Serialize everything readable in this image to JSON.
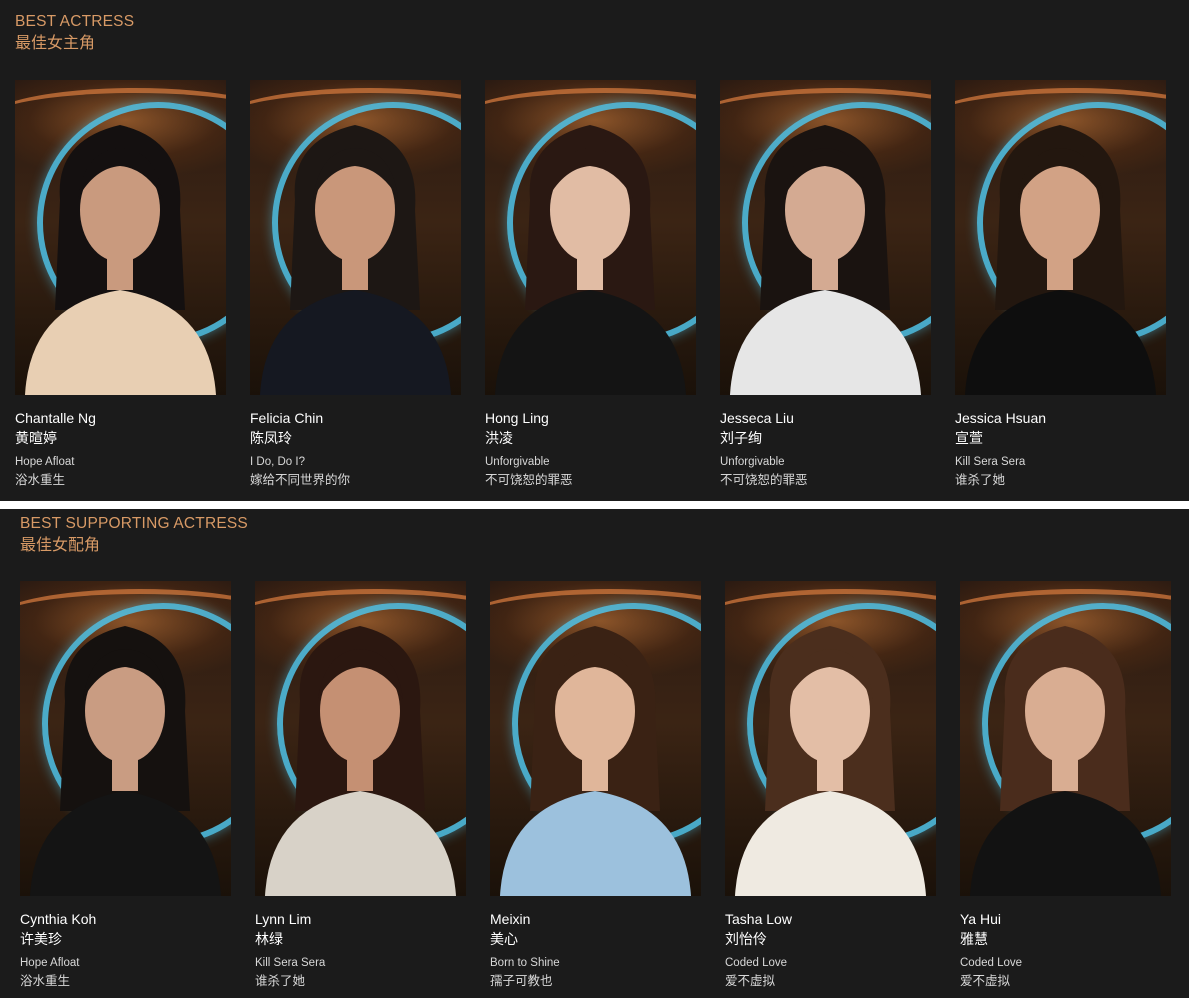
{
  "categories": [
    {
      "title": "BEST ACTRESS",
      "title_zh": "最佳女主角",
      "nominees": [
        {
          "name_en": "Chantalle Ng",
          "name_zh": "黄暄婷",
          "film_en": "Hope Afloat",
          "film_zh": "浴水重生",
          "hair": "#141010",
          "skin": "#c99a7e",
          "outfit": "#e8cfb3"
        },
        {
          "name_en": "Felicia Chin",
          "name_zh": "陈凤玲",
          "film_en": "I Do, Do I?",
          "film_zh": "嫁给不同世界的你",
          "hair": "#1d1714",
          "skin": "#c9977a",
          "outfit": "#151821"
        },
        {
          "name_en": "Hong Ling",
          "name_zh": "洪凌",
          "film_en": "Unforgivable",
          "film_zh": "不可饶恕的罪恶",
          "hair": "#2a1812",
          "skin": "#e1bca4",
          "outfit": "#141414"
        },
        {
          "name_en": "Jesseca Liu",
          "name_zh": "刘子绚",
          "film_en": "Unforgivable",
          "film_zh": "不可饶恕的罪恶",
          "hair": "#1a1310",
          "skin": "#d4aa92",
          "outfit": "#e6e6e6"
        },
        {
          "name_en": "Jessica Hsuan",
          "name_zh": "宣萱",
          "film_en": "Kill Sera Sera",
          "film_zh": "谁杀了她",
          "hair": "#23170f",
          "skin": "#d2a285",
          "outfit": "#0e0e0e"
        }
      ]
    },
    {
      "title": "BEST SUPPORTING ACTRESS",
      "title_zh": "最佳女配角",
      "nominees": [
        {
          "name_en": "Cynthia Koh",
          "name_zh": "许美珍",
          "film_en": "Hope Afloat",
          "film_zh": "浴水重生",
          "hair": "#15110f",
          "skin": "#c99c82",
          "outfit": "#141414"
        },
        {
          "name_en": "Lynn Lim",
          "name_zh": "林绿",
          "film_en": "Kill Sera Sera",
          "film_zh": "谁杀了她",
          "hair": "#2b1710",
          "skin": "#c59073",
          "outfit": "#d8d2c8"
        },
        {
          "name_en": "Meixin",
          "name_zh": "美心",
          "film_en": "Born to Shine",
          "film_zh": "孺子可教也",
          "hair": "#3a2214",
          "skin": "#e0b69a",
          "outfit": "#9cc1dd"
        },
        {
          "name_en": "Tasha Low",
          "name_zh": "刘怡伶",
          "film_en": "Coded Love",
          "film_zh": "爱不虚拟",
          "hair": "#4b2e1d",
          "skin": "#e3bea6",
          "outfit": "#efeae1"
        },
        {
          "name_en": "Ya Hui",
          "name_zh": "雅慧",
          "film_en": "Coded Love",
          "film_zh": "爱不虚拟",
          "hair": "#4a2c1c",
          "skin": "#d9ad92",
          "outfit": "#121212"
        }
      ]
    }
  ]
}
